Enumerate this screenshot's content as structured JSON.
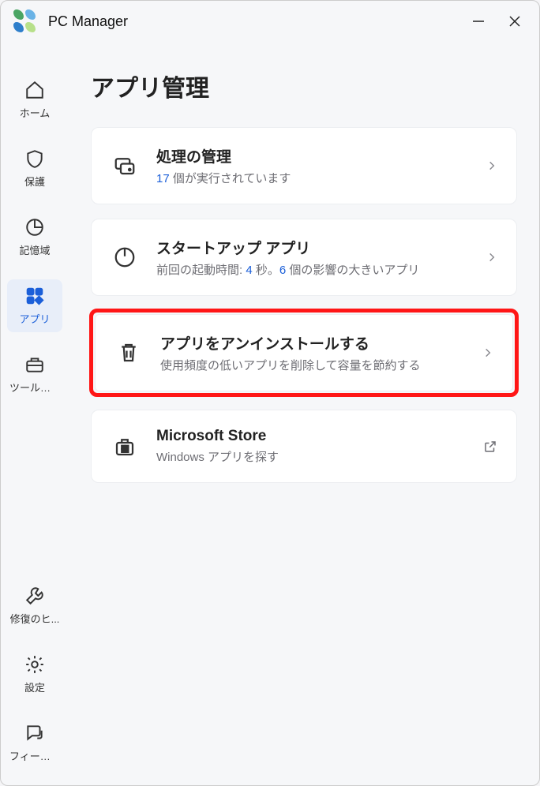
{
  "window": {
    "title": "PC Manager"
  },
  "sidebar": {
    "items": [
      {
        "label": "ホーム"
      },
      {
        "label": "保護"
      },
      {
        "label": "記憶域"
      },
      {
        "label": "アプリ"
      },
      {
        "label": "ツールボッ..."
      }
    ],
    "bottom": [
      {
        "label": "修復のヒ..."
      },
      {
        "label": "設定"
      },
      {
        "label": "フィードバ..."
      }
    ]
  },
  "page": {
    "title": "アプリ管理"
  },
  "cards": {
    "process": {
      "title": "処理の管理",
      "sub_prefix": "",
      "count": "17",
      "sub_suffix": " 個が実行されています"
    },
    "startup": {
      "title": "スタートアップ アプリ",
      "sub_prefix": "前回の起動時間: ",
      "seconds": "4",
      "sub_mid": " 秒。",
      "impact_count": "6",
      "sub_suffix": " 個の影響の大きいアプリ"
    },
    "uninstall": {
      "title": "アプリをアンインストールする",
      "sub": "使用頻度の低いアプリを削除して容量を節約する"
    },
    "store": {
      "title": "Microsoft Store",
      "sub": "Windows アプリを探す"
    }
  }
}
